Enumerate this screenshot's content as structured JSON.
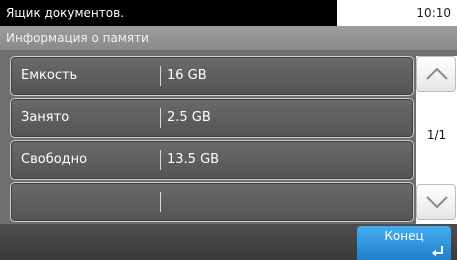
{
  "status_bar": {
    "title": "Ящик документов.",
    "time": "10:10"
  },
  "header": {
    "title": "Информация о памяти"
  },
  "rows": [
    {
      "label": "Емкость",
      "value": "16 GB"
    },
    {
      "label": "Занято",
      "value": "2.5 GB"
    },
    {
      "label": "Свободно",
      "value": "13.5 GB"
    },
    {
      "label": "",
      "value": ""
    }
  ],
  "pager": {
    "indicator": "1/1",
    "up_icon": "chevron-up-icon",
    "down_icon": "chevron-down-icon"
  },
  "footer": {
    "end_label": "Конец",
    "enter_icon": "enter-icon"
  }
}
